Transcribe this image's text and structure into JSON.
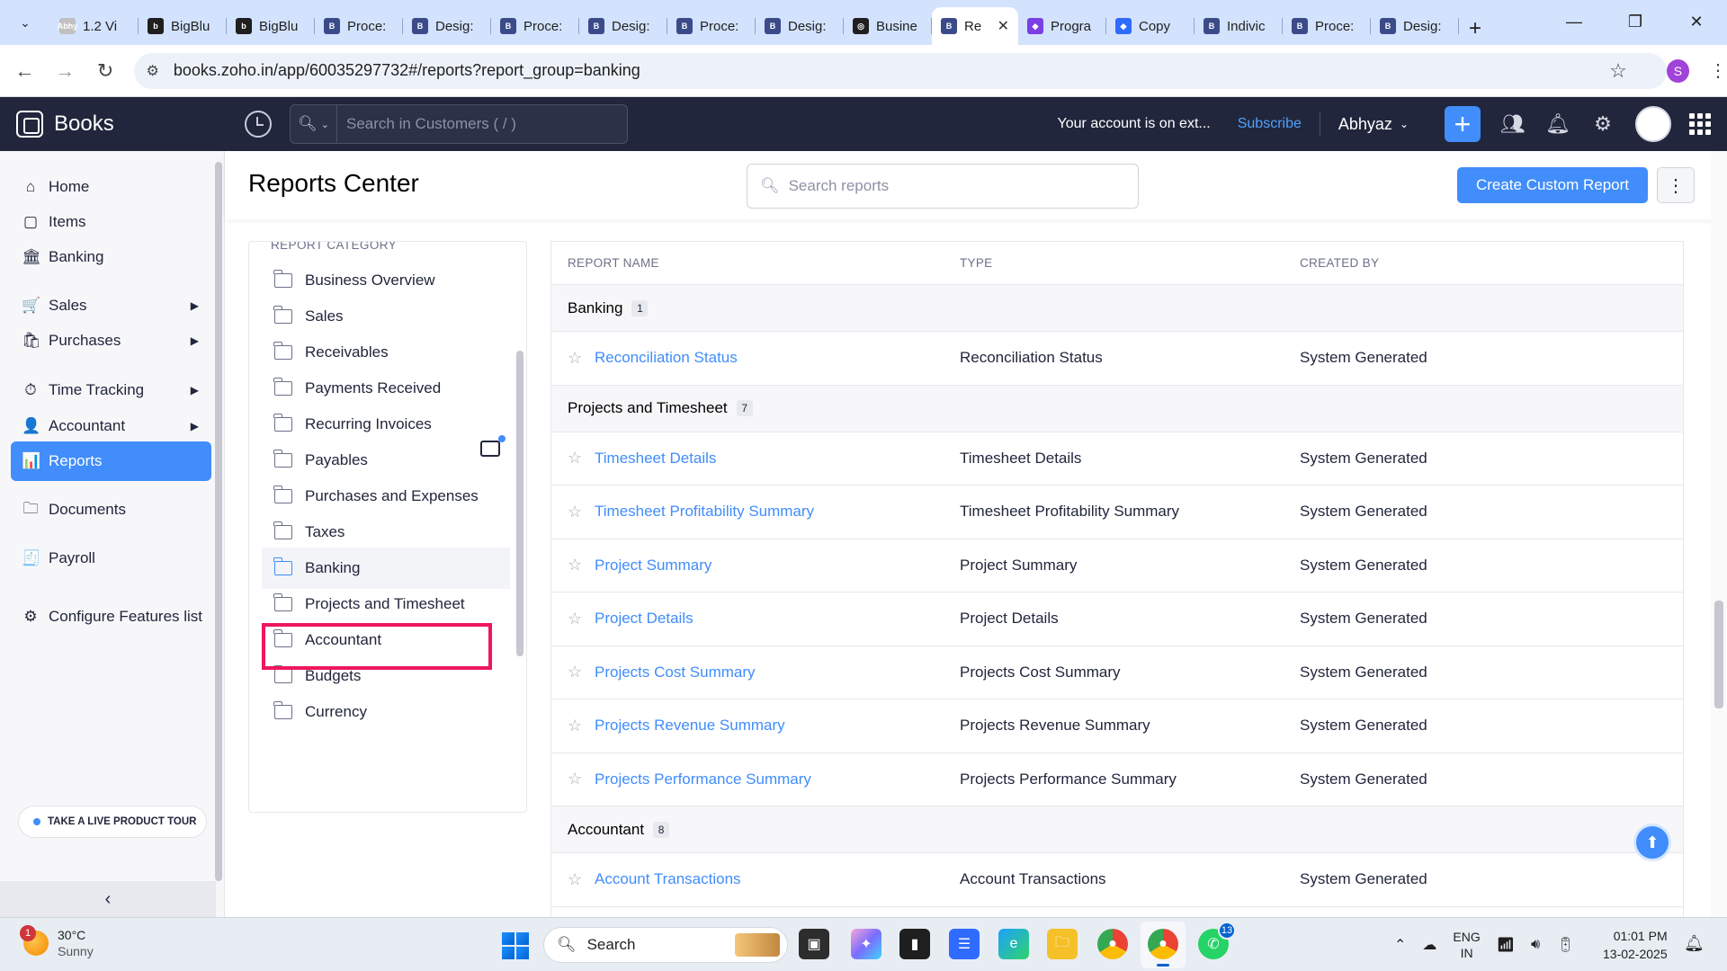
{
  "browser": {
    "tabs": [
      {
        "label": "1.2 Vi",
        "favicon_color": "#c0c0c0",
        "favicon_glyph": "Abhy"
      },
      {
        "label": "BigBlu",
        "favicon_color": "#1f1f1f",
        "favicon_glyph": "b"
      },
      {
        "label": "BigBlu",
        "favicon_color": "#1f1f1f",
        "favicon_glyph": "b"
      },
      {
        "label": "Proce:",
        "favicon_color": "#3b4b8a",
        "favicon_glyph": "B"
      },
      {
        "label": "Desig:",
        "favicon_color": "#3b4b8a",
        "favicon_glyph": "B"
      },
      {
        "label": "Proce:",
        "favicon_color": "#3b4b8a",
        "favicon_glyph": "B"
      },
      {
        "label": "Desig:",
        "favicon_color": "#3b4b8a",
        "favicon_glyph": "B"
      },
      {
        "label": "Proce:",
        "favicon_color": "#3b4b8a",
        "favicon_glyph": "B"
      },
      {
        "label": "Desig:",
        "favicon_color": "#3b4b8a",
        "favicon_glyph": "B"
      },
      {
        "label": "Busine",
        "favicon_color": "#1f1f1f",
        "favicon_glyph": "◎"
      },
      {
        "label": "Re",
        "favicon_color": "#3b4b8a",
        "favicon_glyph": "B",
        "active": true
      },
      {
        "label": "Progra",
        "favicon_color": "#7b3fe4",
        "favicon_glyph": "◆"
      },
      {
        "label": "Copy",
        "favicon_color": "#2f6bff",
        "favicon_glyph": "◆"
      },
      {
        "label": "Indivic",
        "favicon_color": "#3b4b8a",
        "favicon_glyph": "B"
      },
      {
        "label": "Proce:",
        "favicon_color": "#3b4b8a",
        "favicon_glyph": "B"
      },
      {
        "label": "Desig:",
        "favicon_color": "#3b4b8a",
        "favicon_glyph": "B"
      }
    ],
    "url": "books.zoho.in/app/60035297732#/reports?report_group=banking",
    "profile_initial": "S"
  },
  "app": {
    "brand": "Books",
    "search_placeholder": "Search in Customers ( / )",
    "account_message": "Your account is on ext...",
    "subscribe": "Subscribe",
    "org_name": "Abhyaz"
  },
  "sidebar": {
    "items": [
      {
        "label": "Home",
        "icon": "⌂",
        "name": "home"
      },
      {
        "label": "Items",
        "icon": "▢",
        "name": "items"
      },
      {
        "label": "Banking",
        "icon": "🏛",
        "name": "banking"
      },
      {
        "label": "Sales",
        "icon": "🛒",
        "name": "sales",
        "caret": true
      },
      {
        "label": "Purchases",
        "icon": "🛍",
        "name": "purchases",
        "caret": true
      },
      {
        "label": "Time Tracking",
        "icon": "⏱",
        "name": "time-tracking",
        "caret": true
      },
      {
        "label": "Accountant",
        "icon": "👤",
        "name": "accountant",
        "caret": true
      },
      {
        "label": "Reports",
        "icon": "📊",
        "name": "reports",
        "active": true
      },
      {
        "label": "Documents",
        "icon": "🗀",
        "name": "documents"
      },
      {
        "label": "Payroll",
        "icon": "🧾",
        "name": "payroll"
      },
      {
        "label": "Configure Features list",
        "icon": "⚙",
        "name": "configure-features"
      }
    ],
    "tour_label": "TAKE A LIVE PRODUCT TOUR"
  },
  "main": {
    "title": "Reports Center",
    "search_placeholder": "Search reports",
    "create_button": "Create Custom Report",
    "category_header": "REPORT CATEGORY",
    "categories": [
      "Business Overview",
      "Sales",
      "Receivables",
      "Payments Received",
      "Recurring Invoices",
      "Payables",
      "Purchases and Expenses",
      "Taxes",
      "Banking",
      "Projects and Timesheet",
      "Accountant",
      "Budgets",
      "Currency"
    ],
    "selected_category": "Banking",
    "columns": [
      "REPORT NAME",
      "TYPE",
      "CREATED BY"
    ],
    "groups": [
      {
        "name": "Banking",
        "count": "1",
        "reports": [
          {
            "name": "Reconciliation Status",
            "type": "Reconciliation Status",
            "created_by": "System Generated"
          }
        ]
      },
      {
        "name": "Projects and Timesheet",
        "count": "7",
        "reports": [
          {
            "name": "Timesheet Details",
            "type": "Timesheet Details",
            "created_by": "System Generated"
          },
          {
            "name": "Timesheet Profitability Summary",
            "type": "Timesheet Profitability Summary",
            "created_by": "System Generated"
          },
          {
            "name": "Project Summary",
            "type": "Project Summary",
            "created_by": "System Generated"
          },
          {
            "name": "Project Details",
            "type": "Project Details",
            "created_by": "System Generated"
          },
          {
            "name": "Projects Cost Summary",
            "type": "Projects Cost Summary",
            "created_by": "System Generated"
          },
          {
            "name": "Projects Revenue Summary",
            "type": "Projects Revenue Summary",
            "created_by": "System Generated"
          },
          {
            "name": "Projects Performance Summary",
            "type": "Projects Performance Summary",
            "created_by": "System Generated"
          }
        ]
      },
      {
        "name": "Accountant",
        "count": "8",
        "reports": [
          {
            "name": "Account Transactions",
            "type": "Account Transactions",
            "created_by": "System Generated"
          }
        ]
      }
    ]
  },
  "taskbar": {
    "weather_temp": "30°C",
    "weather_cond": "Sunny",
    "weather_badge": "1",
    "search_label": "Search",
    "lang_1": "ENG",
    "lang_2": "IN",
    "time": "01:01 PM",
    "date": "13-02-2025",
    "whatsapp_badge": "13"
  }
}
